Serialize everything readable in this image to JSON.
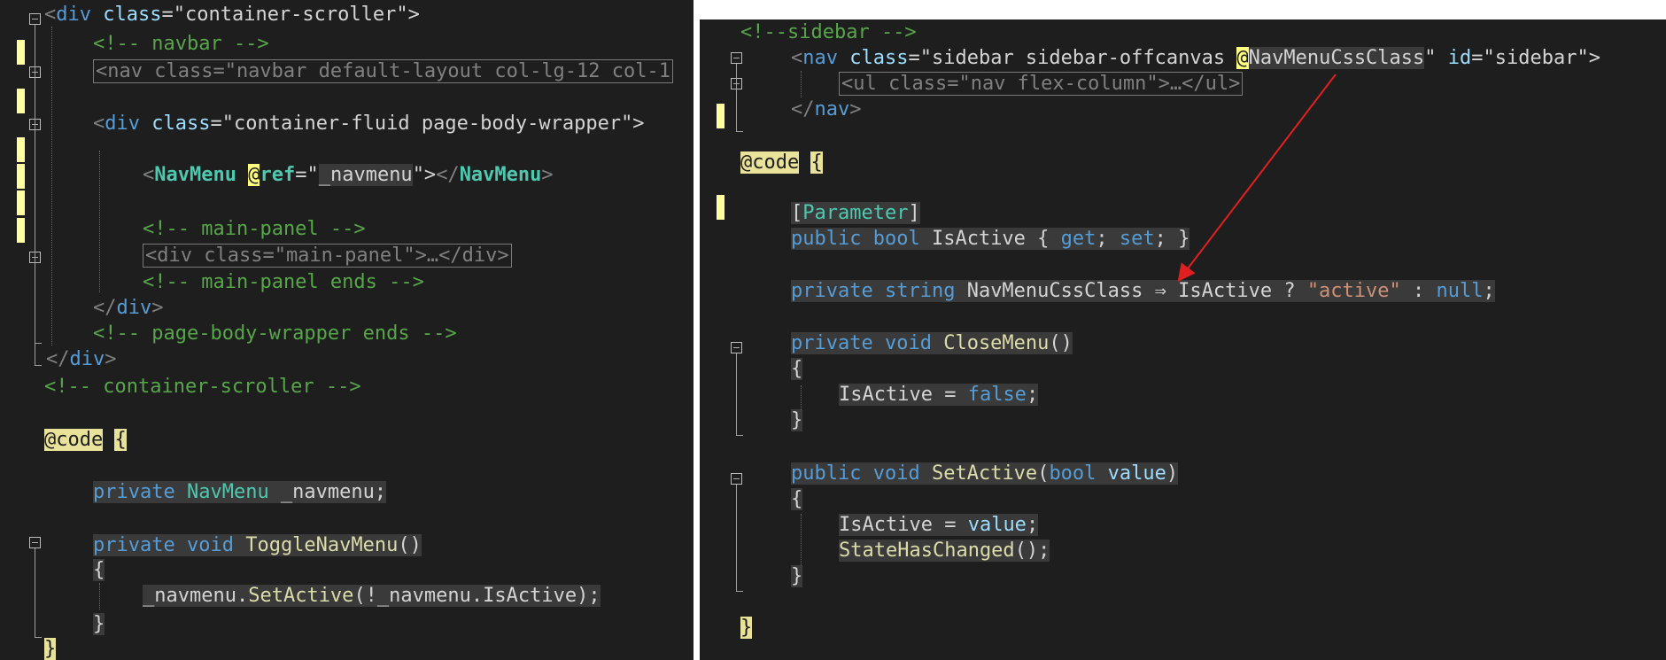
{
  "left_editor": {
    "lines": [
      [
        {
          "t": "<",
          "c": "c-punct"
        },
        {
          "t": "div",
          "c": "c-tag"
        },
        {
          "t": " class",
          "c": "c-attr"
        },
        {
          "t": "=\"container-scroller\">",
          "c": "c-str"
        }
      ],
      [
        {
          "t": "<!-- navbar -->",
          "c": "c-comment"
        }
      ],
      [
        {
          "t": "<nav class=\"navbar default-layout col-lg-12 col-1",
          "c": "c-collapsed"
        }
      ],
      [],
      [
        {
          "t": "<",
          "c": "c-punct"
        },
        {
          "t": "div",
          "c": "c-tag"
        },
        {
          "t": " class",
          "c": "c-attr"
        },
        {
          "t": "=\"container-fluid page-body-wrapper\">",
          "c": "c-str"
        }
      ],
      [],
      [
        {
          "t": "<",
          "c": "c-punct"
        },
        {
          "t": "NavMenu",
          "c": "c-comp"
        },
        {
          "t": " ",
          "c": "c-text"
        },
        {
          "t": "@",
          "c": "c-at"
        },
        {
          "t": "ref",
          "c": "c-comp"
        },
        {
          "t": "=\"",
          "c": "c-str"
        },
        {
          "t": "_navmenu",
          "c": "c-ident hl"
        },
        {
          "t": "\">",
          "c": "c-str"
        },
        {
          "t": "</",
          "c": "c-punct"
        },
        {
          "t": "NavMenu",
          "c": "c-comp"
        },
        {
          "t": ">",
          "c": "c-punct"
        }
      ],
      [],
      [
        {
          "t": "<!-- main-panel -->",
          "c": "c-comment"
        }
      ],
      [
        {
          "t": "<div class=\"main-panel\">…</div>",
          "c": "c-collapsed"
        }
      ],
      [
        {
          "t": "<!-- main-panel ends -->",
          "c": "c-comment"
        }
      ],
      [
        {
          "t": "</",
          "c": "c-punct"
        },
        {
          "t": "div",
          "c": "c-tag"
        },
        {
          "t": ">",
          "c": "c-punct"
        }
      ],
      [
        {
          "t": "<!-- page-body-wrapper ends -->",
          "c": "c-comment"
        }
      ],
      [
        {
          "t": "</",
          "c": "c-punct"
        },
        {
          "t": "div",
          "c": "c-tag"
        },
        {
          "t": ">",
          "c": "c-punct"
        }
      ],
      [
        {
          "t": "<!-- container-scroller -->",
          "c": "c-comment"
        }
      ],
      [],
      [
        {
          "t": "@code",
          "c": "c-razorkw"
        },
        {
          "t": " ",
          "c": "c-text"
        },
        {
          "t": "{",
          "c": "c-razorbrace"
        }
      ],
      [],
      [
        {
          "t": "private",
          "c": "c-kw hl"
        },
        {
          "t": " ",
          "c": "c-text hl"
        },
        {
          "t": "NavMenu",
          "c": "c-type hl"
        },
        {
          "t": " _navmenu;",
          "c": "c-ident hl"
        }
      ],
      [],
      [
        {
          "t": "private",
          "c": "c-kw hl"
        },
        {
          "t": " ",
          "c": "c-text hl"
        },
        {
          "t": "void",
          "c": "c-kw hl"
        },
        {
          "t": " ",
          "c": "c-text hl"
        },
        {
          "t": "ToggleNavMenu",
          "c": "c-method hl"
        },
        {
          "t": "()",
          "c": "c-ident hl"
        }
      ],
      [
        {
          "t": "{",
          "c": "c-ident hl"
        }
      ],
      [
        {
          "t": "_navmenu.",
          "c": "c-ident hl"
        },
        {
          "t": "SetActive",
          "c": "c-method hl"
        },
        {
          "t": "(!_navmenu.IsActive);",
          "c": "c-ident hl"
        }
      ],
      [
        {
          "t": "}",
          "c": "c-ident hl"
        }
      ],
      [
        {
          "t": "}",
          "c": "c-razorbrace"
        }
      ]
    ]
  },
  "right_editor": {
    "lines": [
      [
        {
          "t": "<!--sidebar -->",
          "c": "c-comment"
        }
      ],
      [
        {
          "t": "<",
          "c": "c-punct"
        },
        {
          "t": "nav",
          "c": "c-tag"
        },
        {
          "t": " class",
          "c": "c-attr"
        },
        {
          "t": "=\"sidebar sidebar-offcanvas ",
          "c": "c-str"
        },
        {
          "t": "@",
          "c": "c-at"
        },
        {
          "t": "NavMenuCssClass",
          "c": "c-ident hl"
        },
        {
          "t": "\"",
          "c": "c-str"
        },
        {
          "t": " id",
          "c": "c-attr"
        },
        {
          "t": "=\"sidebar\">",
          "c": "c-str"
        }
      ],
      [
        {
          "t": "<ul class=\"nav flex-column\">…</ul>",
          "c": "c-collapsed"
        }
      ],
      [
        {
          "t": "</",
          "c": "c-punct"
        },
        {
          "t": "nav",
          "c": "c-tag"
        },
        {
          "t": ">",
          "c": "c-punct"
        }
      ],
      [],
      [
        {
          "t": "@code",
          "c": "c-razorkw"
        },
        {
          "t": " ",
          "c": "c-text"
        },
        {
          "t": "{",
          "c": "c-razorbrace"
        }
      ],
      [],
      [
        {
          "t": "[",
          "c": "c-ident hl"
        },
        {
          "t": "Parameter",
          "c": "c-type hl"
        },
        {
          "t": "]",
          "c": "c-ident hl"
        }
      ],
      [
        {
          "t": "public",
          "c": "c-kw hl"
        },
        {
          "t": " ",
          "c": "c-text hl"
        },
        {
          "t": "bool",
          "c": "c-kw hl"
        },
        {
          "t": " IsActive { ",
          "c": "c-ident hl"
        },
        {
          "t": "get",
          "c": "c-kw hl"
        },
        {
          "t": "; ",
          "c": "c-ident hl"
        },
        {
          "t": "set",
          "c": "c-kw hl"
        },
        {
          "t": "; }",
          "c": "c-ident hl"
        }
      ],
      [],
      [
        {
          "t": "private",
          "c": "c-kw hl"
        },
        {
          "t": " ",
          "c": "c-text hl"
        },
        {
          "t": "string",
          "c": "c-kw hl"
        },
        {
          "t": " NavMenuCssClass ⇒ IsActive ? ",
          "c": "c-ident hl"
        },
        {
          "t": "\"active\"",
          "c": "c-quote hl"
        },
        {
          "t": " : ",
          "c": "c-ident hl"
        },
        {
          "t": "null",
          "c": "c-kw hl"
        },
        {
          "t": ";",
          "c": "c-ident hl"
        }
      ],
      [],
      [
        {
          "t": "private",
          "c": "c-kw hl"
        },
        {
          "t": " ",
          "c": "c-text hl"
        },
        {
          "t": "void",
          "c": "c-kw hl"
        },
        {
          "t": " ",
          "c": "c-text hl"
        },
        {
          "t": "CloseMenu",
          "c": "c-method hl"
        },
        {
          "t": "()",
          "c": "c-ident hl"
        }
      ],
      [
        {
          "t": "{",
          "c": "c-ident hl"
        }
      ],
      [
        {
          "t": "IsActive = ",
          "c": "c-ident hl"
        },
        {
          "t": "false",
          "c": "c-kw hl"
        },
        {
          "t": ";",
          "c": "c-ident hl"
        }
      ],
      [
        {
          "t": "}",
          "c": "c-ident hl"
        }
      ],
      [],
      [
        {
          "t": "public",
          "c": "c-kw hl"
        },
        {
          "t": " ",
          "c": "c-text hl"
        },
        {
          "t": "void",
          "c": "c-kw hl"
        },
        {
          "t": " ",
          "c": "c-text hl"
        },
        {
          "t": "SetActive",
          "c": "c-method hl"
        },
        {
          "t": "(",
          "c": "c-ident hl"
        },
        {
          "t": "bool",
          "c": "c-kw hl"
        },
        {
          "t": " ",
          "c": "c-text hl"
        },
        {
          "t": "value",
          "c": "c-attr hl"
        },
        {
          "t": ")",
          "c": "c-ident hl"
        }
      ],
      [
        {
          "t": "{",
          "c": "c-ident hl"
        }
      ],
      [
        {
          "t": "IsActive = ",
          "c": "c-ident hl"
        },
        {
          "t": "value",
          "c": "c-attr hl"
        },
        {
          "t": ";",
          "c": "c-ident hl"
        }
      ],
      [
        {
          "t": "StateHasChanged",
          "c": "c-method hl"
        },
        {
          "t": "();",
          "c": "c-ident hl"
        }
      ],
      [
        {
          "t": "}",
          "c": "c-ident hl"
        }
      ],
      [],
      [
        {
          "t": "}",
          "c": "c-razorbrace"
        }
      ]
    ]
  }
}
